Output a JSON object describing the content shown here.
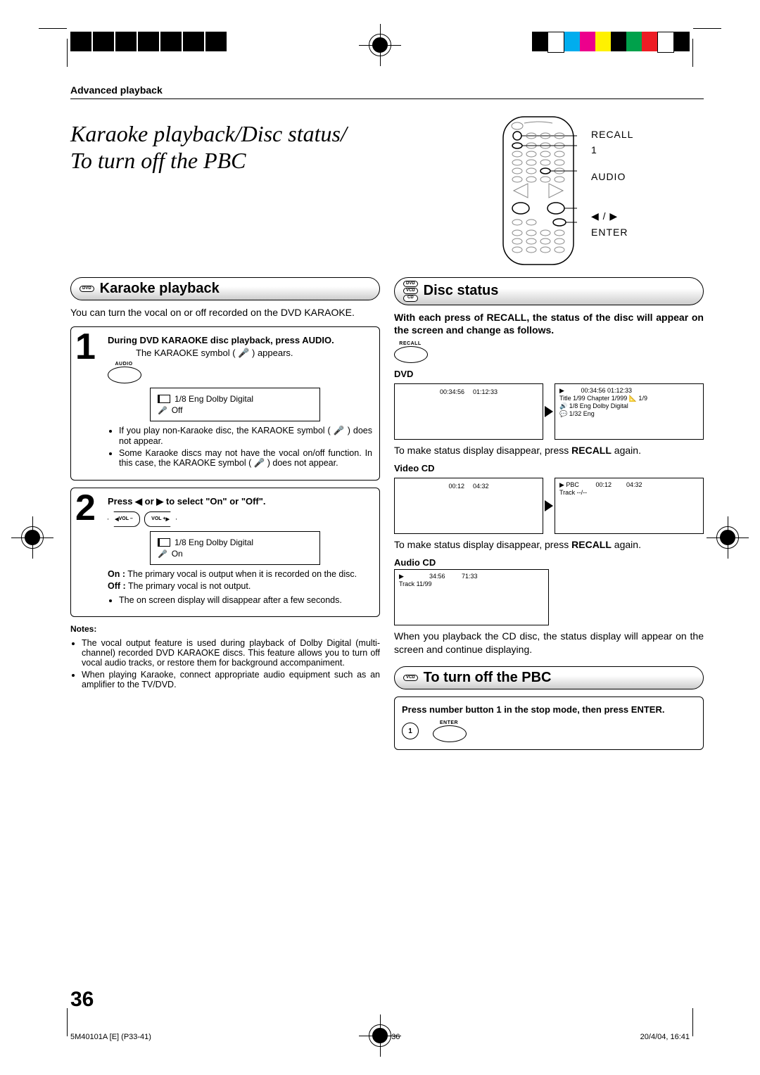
{
  "header": {
    "section": "Advanced playback",
    "title_line1": "Karaoke playback/Disc status/",
    "title_line2": "To turn off the PBC"
  },
  "remote_labels": {
    "recall": "RECALL",
    "one": "1",
    "audio": "AUDIO",
    "arrows": "◀ / ▶",
    "enter": "ENTER"
  },
  "karaoke": {
    "badge": "DVD",
    "title": "Karaoke playback",
    "intro": "You can turn the vocal on or off recorded on the DVD KARAOKE.",
    "step1": {
      "num": "1",
      "head": "During DVD KARAOKE disc playback, press AUDIO.",
      "line": "The KARAOKE symbol ( 🎤 ) appears.",
      "btn_label": "AUDIO",
      "osd1": "1/8 Eng Dolby Digital",
      "osd2": "Off",
      "notes": [
        "If you play non-Karaoke disc, the KARAOKE symbol ( 🎤 ) does not appear.",
        "Some Karaoke discs may not have the vocal on/off function. In this case, the KARAOKE symbol ( 🎤 ) does not appear."
      ]
    },
    "step2": {
      "num": "2",
      "head": "Press ◀ or ▶ to select \"On\" or \"Off\".",
      "vol_minus": "VOL –",
      "vol_plus": "VOL +",
      "osd1": "1/8 Eng Dolby Digital",
      "osd2": "On",
      "on_line": "On : The primary vocal is output when it is recorded on the disc.",
      "off_line": "Off : The primary vocal is not output.",
      "notes": [
        "The on screen display will disappear after a few seconds."
      ]
    },
    "notes_head": "Notes:",
    "footnotes": [
      "The vocal output feature is used during playback of Dolby Digital (multi-channel) recorded DVD KARAOKE discs. This feature allows you to turn off vocal audio tracks, or restore them for background accompaniment.",
      "When playing Karaoke, connect appropriate audio equipment such as an amplifier to the TV/DVD."
    ]
  },
  "disc_status": {
    "badges": [
      "DVD",
      "VCD",
      "CD"
    ],
    "title": "Disc status",
    "intro": "With each press of RECALL, the status of the disc will appear on the screen and change as follows.",
    "recall_label": "RECALL",
    "dvd": {
      "head": "DVD",
      "left": {
        "t1": "00:34:56",
        "t2": "01:12:33"
      },
      "right": {
        "play": "▶",
        "times": "00:34:56 01:12:33",
        "title": "Title    1/99   Chapter 1/999  📐 1/9",
        "audio": "🔊 1/8  Eng Dolby Digital",
        "sub": "💬 1/32  Eng"
      },
      "note": "To make status display disappear, press RECALL again."
    },
    "vcd": {
      "head": "Video CD",
      "left": {
        "t1": "00:12",
        "t2": "04:32"
      },
      "right": {
        "pbc": "▶ PBC",
        "t1": "00:12",
        "t2": "04:32",
        "track": "Track   --/--"
      },
      "note": "To make status display disappear, press RECALL again."
    },
    "acd": {
      "head": "Audio CD",
      "play": "▶",
      "t1": "34:56",
      "t2": "71:33",
      "track": "Track 11/99",
      "note": "When you playback the CD disc, the status display will appear on the screen and continue displaying."
    }
  },
  "pbc": {
    "badge": "VCD",
    "title": "To turn off the PBC",
    "head": "Press number button 1 in the stop mode, then press ENTER.",
    "num": "1",
    "enter_label": "ENTER"
  },
  "page_number": "36",
  "footer": {
    "left": "5M40101A [E] (P33-41)",
    "center": "36",
    "right": "20/4/04, 16:41"
  },
  "colorbar": [
    "#000000",
    "#ffffff",
    "#00adee",
    "#ed008c",
    "#fff100",
    "#000000",
    "#00a14b",
    "#ed1c24",
    "#ffffff",
    "#000000"
  ]
}
